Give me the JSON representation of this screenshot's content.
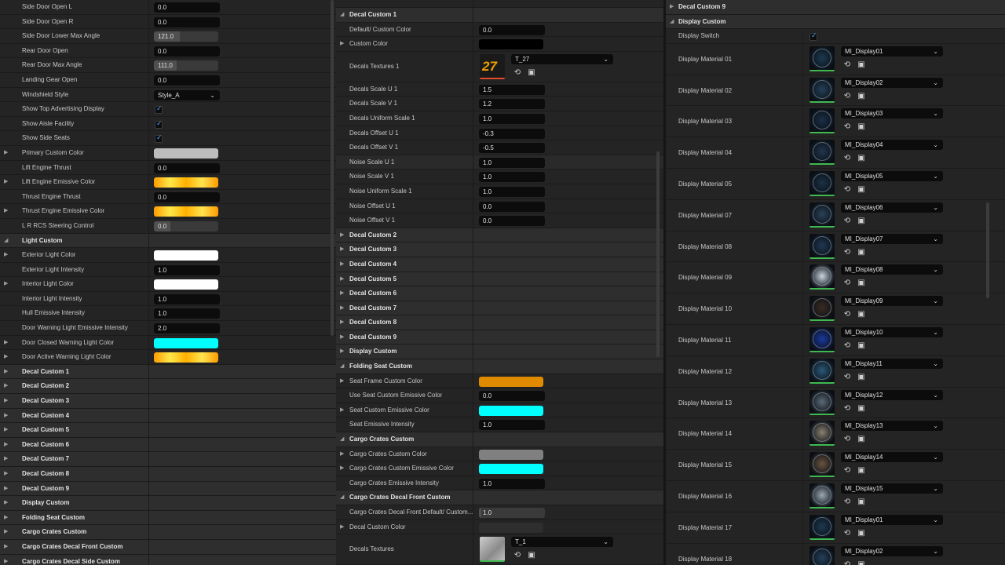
{
  "left_panel": {
    "rows": [
      {
        "label": "Side Door Open L",
        "value": "0.0"
      },
      {
        "label": "Side Door Open R",
        "value": "0.0"
      },
      {
        "label": "Side Door Lower Max Angle",
        "value": "121.0"
      },
      {
        "label": "Rear Door Open",
        "value": "0.0"
      },
      {
        "label": "Rear Door Max Angle",
        "value": "111.0"
      },
      {
        "label": "Landing Gear Open",
        "value": "0.0"
      },
      {
        "label": "Windshield Style",
        "value": "Style_A"
      },
      {
        "label": "Show Top Advertising Display",
        "checked": true
      },
      {
        "label": "Show Aisle Facility",
        "checked": true
      },
      {
        "label": "Show Side Seats",
        "checked": true
      },
      {
        "label": "Primary Custom Color",
        "color": "#bcbcbc"
      },
      {
        "label": "Lift Engine Thrust",
        "value": "0.0"
      },
      {
        "label": "Lift Engine Emissive Color",
        "color": "gold"
      },
      {
        "label": "Thrust Engine Thrust",
        "value": "0.0"
      },
      {
        "label": "Thrust Engine Emissive Color",
        "color": "gold"
      },
      {
        "label": "L R RCS Steering Control",
        "value": "0.0"
      },
      {
        "label": "Light Custom"
      },
      {
        "label": "Exterior Light Color",
        "color": "#ffffff"
      },
      {
        "label": "Exterior Light Intensity",
        "value": "1.0"
      },
      {
        "label": "Interior Light Color",
        "color": "#ffffff"
      },
      {
        "label": "Interior Light Intensity",
        "value": "1.0"
      },
      {
        "label": "Hull Emissive Intensity",
        "value": "1.0"
      },
      {
        "label": "Door Warning Light Emissive Intensity",
        "value": "2.0"
      },
      {
        "label": "Door Closed Warning Light Color",
        "color": "#00ffff"
      },
      {
        "label": "Door Active Warning Light Color",
        "color": "gold"
      },
      {
        "label": "Decal Custom 1"
      },
      {
        "label": "Decal Custom 2"
      },
      {
        "label": "Decal Custom 3"
      },
      {
        "label": "Decal Custom 4"
      },
      {
        "label": "Decal Custom 5"
      },
      {
        "label": "Decal Custom 6"
      },
      {
        "label": "Decal Custom 7"
      },
      {
        "label": "Decal Custom 8"
      },
      {
        "label": "Decal Custom 9"
      },
      {
        "label": "Display Custom"
      },
      {
        "label": "Folding Seat Custom"
      },
      {
        "label": "Cargo Crates Custom"
      },
      {
        "label": "Cargo Crates Decal Front Custom"
      },
      {
        "label": "Cargo Crates Decal Side Custom"
      }
    ]
  },
  "middle_panel": {
    "decal1_header": "Decal Custom 1",
    "default_color_label": "Default/ Custom Color",
    "default_color_value": "0.0",
    "custom_color_label": "Custom Color",
    "decals_textures_label": "Decals Textures 1",
    "texture_name": "T_27",
    "thumb_text": "27",
    "rows_a": [
      {
        "label": "Decals Scale U 1",
        "value": "1.5"
      },
      {
        "label": "Decals Scale V 1",
        "value": "1.2"
      },
      {
        "label": "Decals Uniform Scale 1",
        "value": "1.0"
      },
      {
        "label": "Decals Offset U 1",
        "value": "-0.3"
      },
      {
        "label": "Decals Offset V 1",
        "value": "-0.5"
      },
      {
        "label": "Noise Scale U 1",
        "value": "1.0"
      },
      {
        "label": "Noise Scale V 1",
        "value": "1.0"
      },
      {
        "label": "Noise Uniform Scale 1",
        "value": "1.0"
      },
      {
        "label": "Noise Offset U 1",
        "value": "0.0"
      },
      {
        "label": "Noise Offset V 1",
        "value": "0.0"
      }
    ],
    "collapsed": [
      "Decal Custom 2",
      "Decal Custom 3",
      "Decal Custom 4",
      "Decal Custom 5",
      "Decal Custom 6",
      "Decal Custom 7",
      "Decal Custom 8",
      "Decal Custom 9",
      "Display Custom"
    ],
    "folding_header": "Folding Seat Custom",
    "seat_frame_label": "Seat Frame Custom Color",
    "use_seat_label": "Use Seat Custom Emissive Color",
    "use_seat_value": "0.0",
    "seat_emissive_color_label": "Seat Custom Emissive Color",
    "seat_emissive_int_label": "Seat Emissive Intensity",
    "seat_emissive_int_value": "1.0",
    "cargo_header": "Cargo Crates Custom",
    "cargo_color_label": "Cargo Crates Custom Color",
    "cargo_emissive_label": "Cargo Crates Custom Emissive Color",
    "cargo_emissive_int_label": "Cargo Crates Emissive Intensity",
    "cargo_emissive_int_value": "1.0",
    "cargo_front_header": "Cargo Crates Decal Front Custom",
    "cargo_front_default_label": "Cargo Crates Decal Front Default/ Custom...",
    "cargo_front_default_value": "1.0",
    "cargo_decal_color_label": "Decal Custom Color",
    "cargo_textures_label": "Decals Textures",
    "cargo_texture_name": "T_1"
  },
  "right_panel": {
    "top_header": "Decal Custom 9",
    "display_header": "Display Custom",
    "display_switch_label": "Display Switch",
    "materials": [
      {
        "label": "Display Material 01",
        "value": "MI_Display01",
        "tone": "#1c3a52"
      },
      {
        "label": "Display Material 02",
        "value": "MI_Display02",
        "tone": "#24405a"
      },
      {
        "label": "Display Material 03",
        "value": "MI_Display03",
        "tone": "#1a2f48"
      },
      {
        "label": "Display Material 04",
        "value": "MI_Display04",
        "tone": "#20364e"
      },
      {
        "label": "Display Material 05",
        "value": "MI_Display05",
        "tone": "#1b3147"
      },
      {
        "label": "Display Material 07",
        "value": "MI_Display06",
        "tone": "#2a4258"
      },
      {
        "label": "Display Material 08",
        "value": "MI_Display07",
        "tone": "#203854"
      },
      {
        "label": "Display Material 09",
        "value": "MI_Display08",
        "tone": "#c8d4e0"
      },
      {
        "label": "Display Material 10",
        "value": "MI_Display09",
        "tone": "#3a2c24"
      },
      {
        "label": "Display Material 11",
        "value": "MI_Display10",
        "tone": "#1a3aa0"
      },
      {
        "label": "Display Material 12",
        "value": "MI_Display11",
        "tone": "#2a5a7a"
      },
      {
        "label": "Display Material 13",
        "value": "MI_Display12",
        "tone": "#5a6a78"
      },
      {
        "label": "Display Material 14",
        "value": "MI_Display13",
        "tone": "#8a8070"
      },
      {
        "label": "Display Material 15",
        "value": "MI_Display14",
        "tone": "#6a5440"
      },
      {
        "label": "Display Material 16",
        "value": "MI_Display15",
        "tone": "#9aa8b4"
      },
      {
        "label": "Display Material 17",
        "value": "MI_Display01",
        "tone": "#1c3a52"
      },
      {
        "label": "Display Material 18",
        "value": "MI_Display02",
        "tone": "#24405a"
      }
    ]
  }
}
